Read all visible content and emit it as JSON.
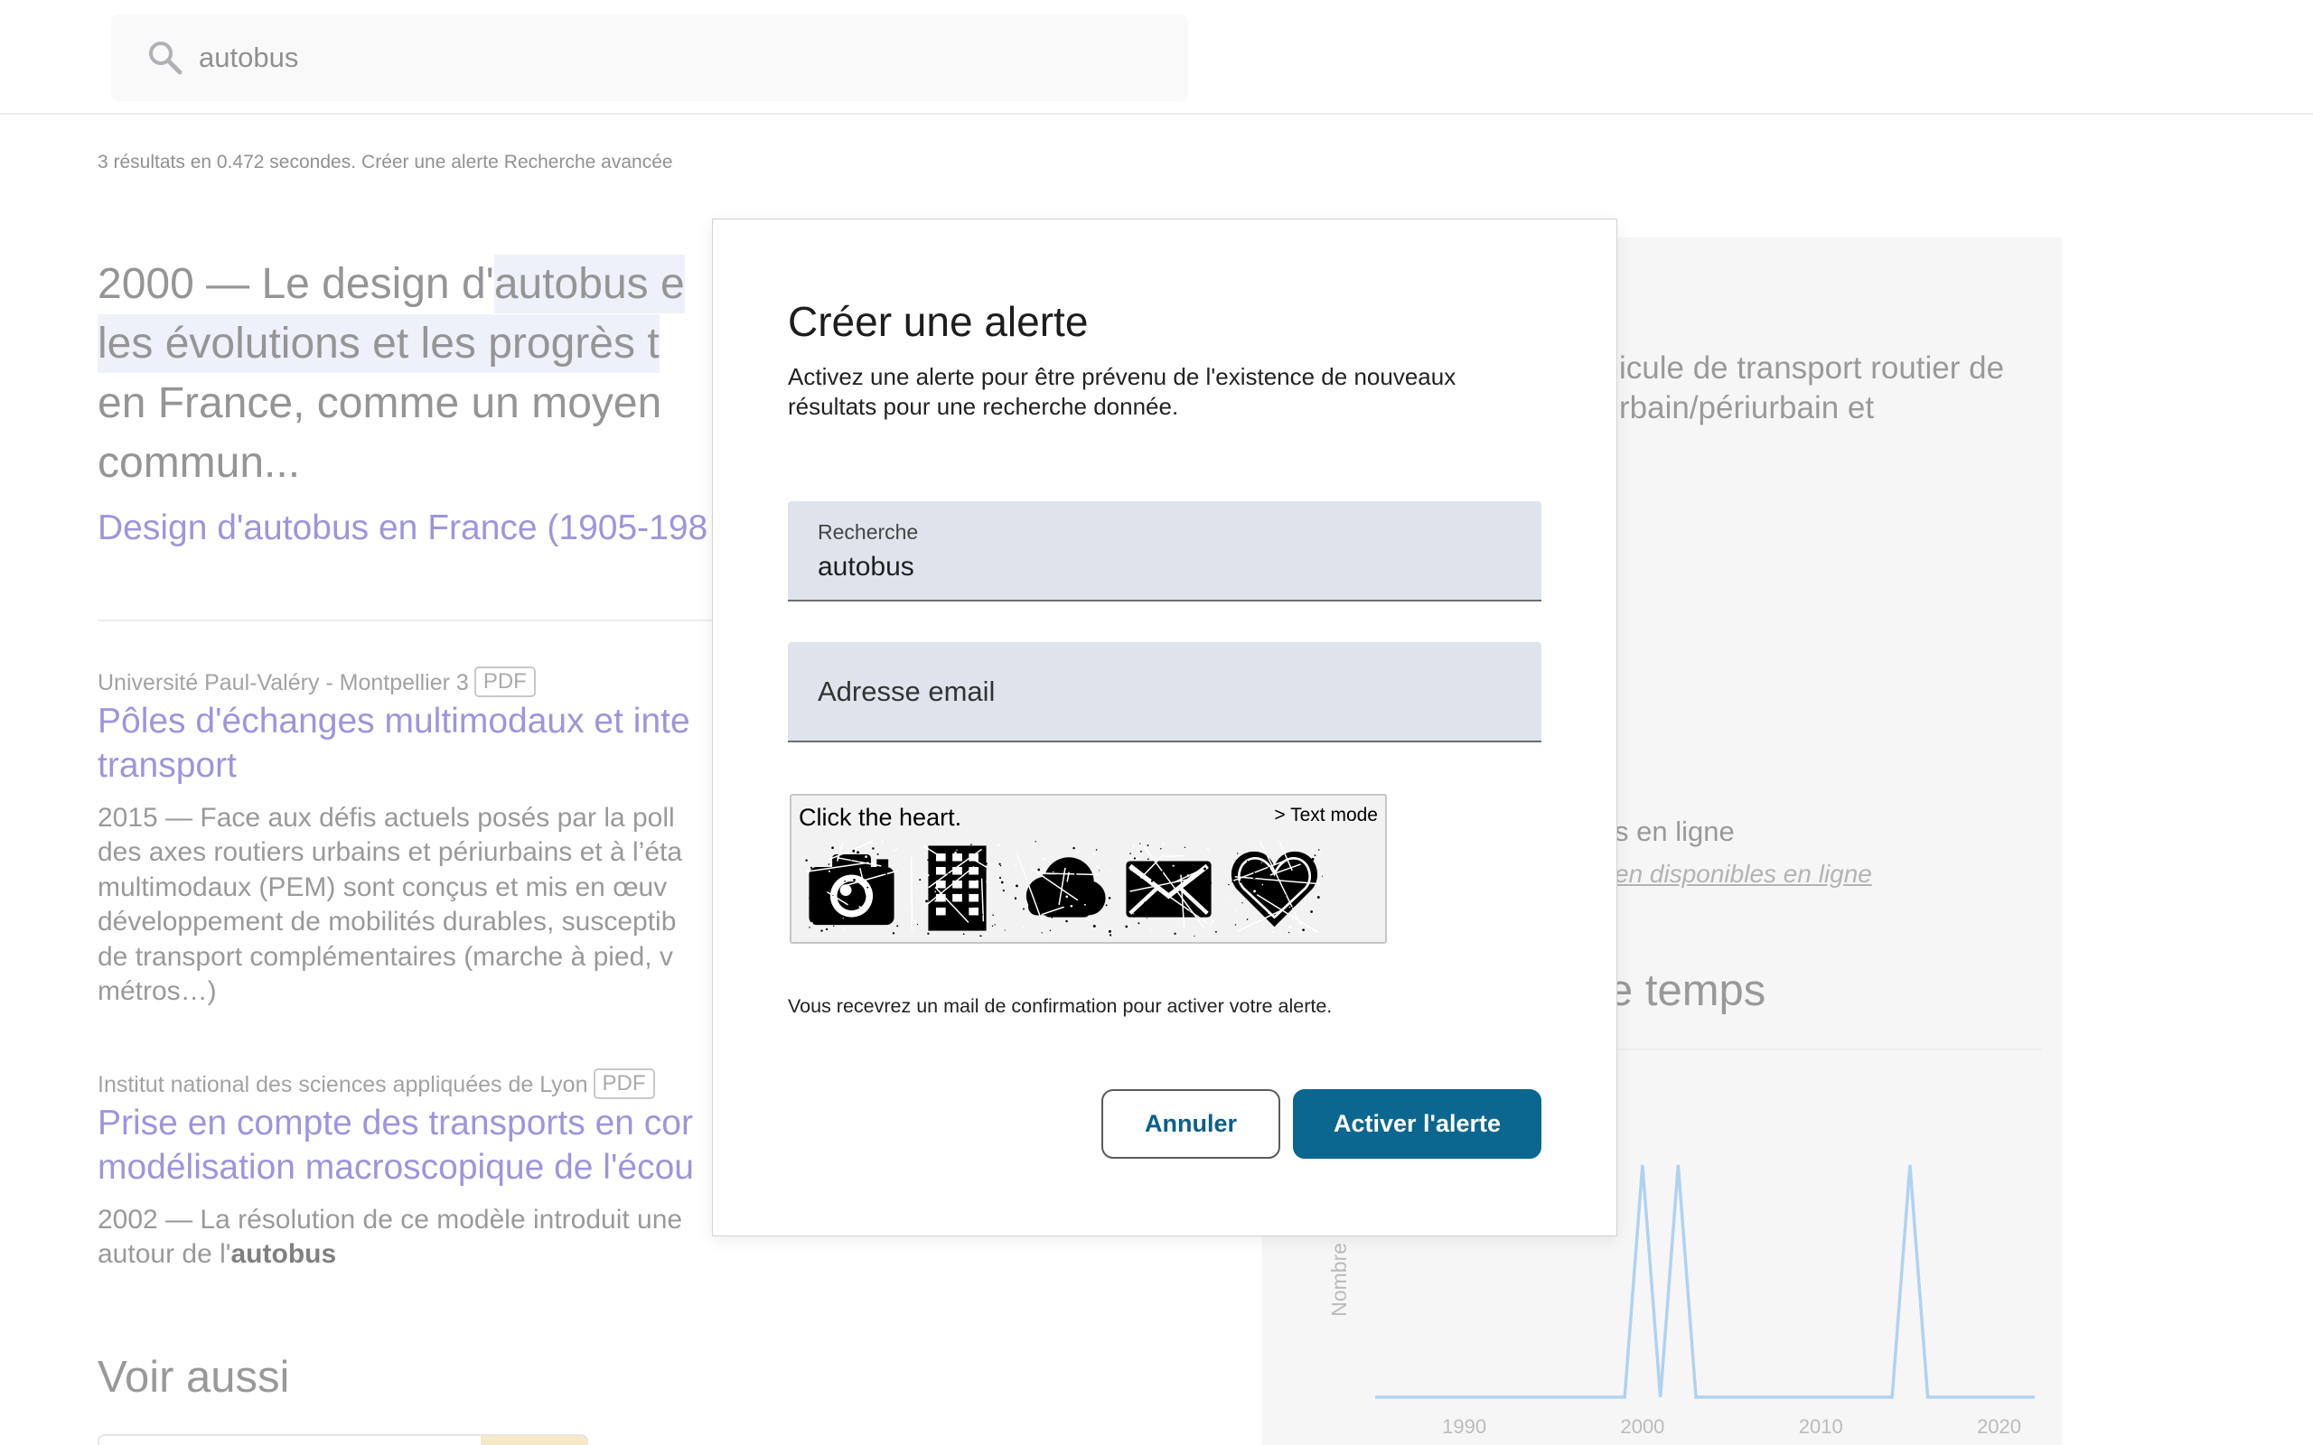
{
  "colors": {
    "accent": "#0b6690",
    "link": "#3b2ab9",
    "chart_line": "#61a5e5",
    "highlight": "#dde3f3"
  },
  "header": {
    "search_value": "autobus",
    "search_icon": "search-icon"
  },
  "stats": {
    "summary": "3 résultats en 0.472 secondes.",
    "create_alert": "Créer une alerte",
    "advanced_search": "Recherche avancée"
  },
  "results": [
    {
      "title_pre": "2000 — Le design d'",
      "title_highlight": "autobus e",
      "line_2_highlight": "les évolutions et les progrès t",
      "line_3": "en France, comme un moyen",
      "line_4": "commun...",
      "link": "Design d'autobus en France (1905-198"
    },
    {
      "source": "Université Paul-Valéry - Montpellier 3",
      "badge": "PDF",
      "title_lines": [
        "Pôles d'échanges multimodaux et inte",
        "transport"
      ],
      "snippet_lines": [
        "2015 — Face aux défis actuels posés par la poll",
        "des axes routiers urbains et périurbains et à l’éta",
        "multimodaux (PEM) sont conçus et mis en œuv",
        "développement de mobilités durables, susceptib",
        "de transport complémentaires (marche à pied, v",
        "métros…)"
      ]
    },
    {
      "source": "Institut national des sciences appliquées de Lyon",
      "badge": "PDF",
      "title_lines": [
        "Prise en compte des transports en cor",
        "modélisation macroscopique de l'écou"
      ],
      "snippet_lines": [
        "2002 — La résolution de ce modèle introduit une"
      ],
      "snippet_tail_pre": "autour de l'",
      "snippet_tail_bold": "autobus"
    }
  ],
  "see_also": {
    "heading": "Voir aussi"
  },
  "side_panel": {
    "summary_lines": [
      "icule de transport routier de",
      "rbain/périurbain et"
    ],
    "online_text": "s en ligne",
    "online_link": "en disponibles en ligne",
    "timeline_heading": "e temps"
  },
  "chart_data": {
    "type": "line",
    "x": [
      1985,
      1986,
      1987,
      1988,
      1989,
      1990,
      1991,
      1992,
      1993,
      1994,
      1995,
      1996,
      1997,
      1998,
      1999,
      2000,
      2001,
      2002,
      2003,
      2004,
      2005,
      2006,
      2007,
      2008,
      2009,
      2010,
      2011,
      2012,
      2013,
      2014,
      2015,
      2016,
      2017,
      2018,
      2019,
      2020,
      2021,
      2022
    ],
    "y": [
      0,
      0,
      0,
      0,
      0,
      0,
      0,
      0,
      0,
      0,
      0,
      0,
      0,
      0,
      0,
      1,
      0,
      1,
      0,
      0,
      0,
      0,
      0,
      0,
      0,
      0,
      0,
      0,
      0,
      0,
      1,
      0,
      0,
      0,
      0,
      0,
      0,
      0
    ],
    "ylabel": "Nombre",
    "xticks": [
      1990,
      2000,
      2010,
      2020
    ],
    "xlim": [
      1985,
      2022
    ],
    "ylim": [
      0,
      1
    ],
    "grid": false,
    "color": "#61a5e5"
  },
  "modal": {
    "title": "Créer une alerte",
    "description": "Activez une alerte pour être prévenu de l'existence de nouveaux résultats pour une recherche donnée.",
    "search_field": {
      "label": "Recherche",
      "value": "autobus"
    },
    "email_field": {
      "placeholder": "Adresse email",
      "value": ""
    },
    "captcha": {
      "instruction": "Click the heart.",
      "text_mode": "> Text mode",
      "icons": [
        "camera-icon",
        "building-icon",
        "cloud-icon",
        "envelope-icon",
        "heart-icon"
      ]
    },
    "confirmation": "Vous recevrez un mail de confirmation pour activer votre alerte.",
    "cancel_label": "Annuler",
    "submit_label": "Activer l'alerte"
  }
}
